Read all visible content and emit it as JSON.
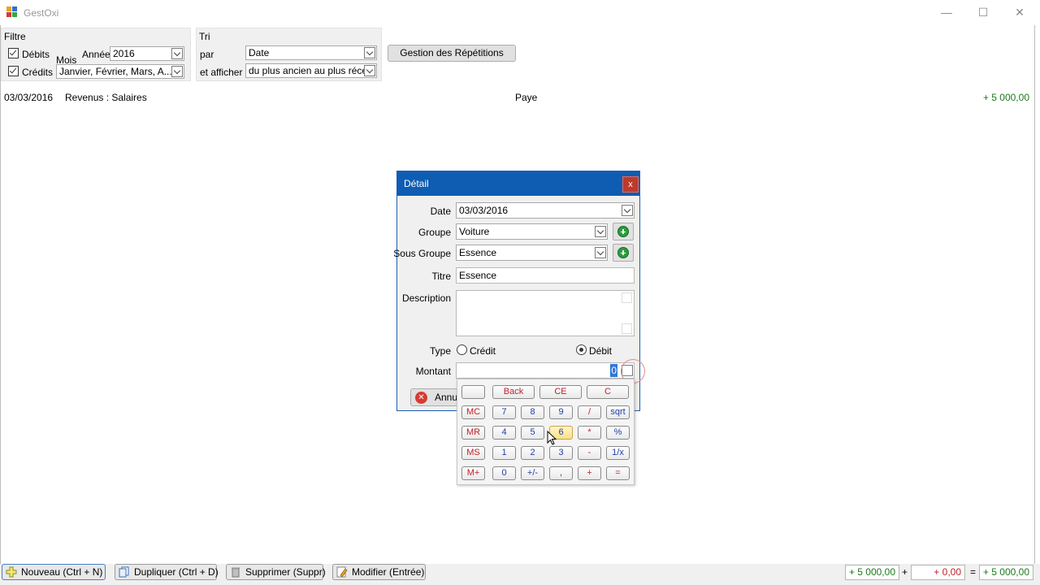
{
  "window": {
    "title": "GestOxi"
  },
  "filter": {
    "title": "Filtre",
    "debits_label": "Débits",
    "debits_checked": true,
    "credits_label": "Crédits",
    "credits_checked": true,
    "mois_label": "Mois",
    "annee_label": "Année",
    "annee_value": "2016",
    "mois_value": "Janvier, Février, Mars, A..."
  },
  "sort": {
    "title": "Tri",
    "par_label": "par",
    "par_value": "Date",
    "afficher_label": "et afficher",
    "afficher_value": "du plus ancien au plus récent"
  },
  "repetitions_button": "Gestion des Répétitions",
  "entries": [
    {
      "date": "03/03/2016",
      "category": "Revenus : Salaires",
      "title": "Paye",
      "amount": "+ 5 000,00"
    }
  ],
  "dialog": {
    "title": "Détail",
    "close": "x",
    "date_label": "Date",
    "date_value": "03/03/2016",
    "groupe_label": "Groupe",
    "groupe_value": "Voiture",
    "sousgroupe_label": "Sous Groupe",
    "sousgroupe_value": "Essence",
    "titre_label": "Titre",
    "titre_value": "Essence",
    "description_label": "Description",
    "type_label": "Type",
    "credit_label": "Crédit",
    "debit_label": "Débit",
    "type_selected": "Débit",
    "montant_label": "Montant",
    "montant_value": "0",
    "cancel_label": "Annu"
  },
  "calculator": {
    "display": "",
    "keys": {
      "back": "Back",
      "ce": "CE",
      "c": "C",
      "mc": "MC",
      "mr": "MR",
      "ms": "MS",
      "mplus": "M+",
      "k7": "7",
      "k8": "8",
      "k9": "9",
      "div": "/",
      "sqrt": "sqrt",
      "k4": "4",
      "k5": "5",
      "k6": "6",
      "mul": "*",
      "pct": "%",
      "k1": "1",
      "k2": "2",
      "k3": "3",
      "minus": "-",
      "inv": "1/x",
      "k0": "0",
      "sign": "+/-",
      "comma": ",",
      "plus": "+",
      "eq": "="
    }
  },
  "toolbar": {
    "nouveau": "Nouveau (Ctrl + N)",
    "dupliquer": "Dupliquer (Ctrl + D)",
    "supprimer": "Supprimer (Suppr)",
    "modifier": "Modifier (Entrée)"
  },
  "totals": {
    "credits": "+ 5 000,00",
    "plus": "+",
    "debits": "+ 0,00",
    "equals": "=",
    "total": "+ 5 000,00"
  },
  "colors": {
    "accent": "#0f5cb3",
    "credit_green": "#1a7a1a",
    "debit_red": "#c0202a"
  }
}
